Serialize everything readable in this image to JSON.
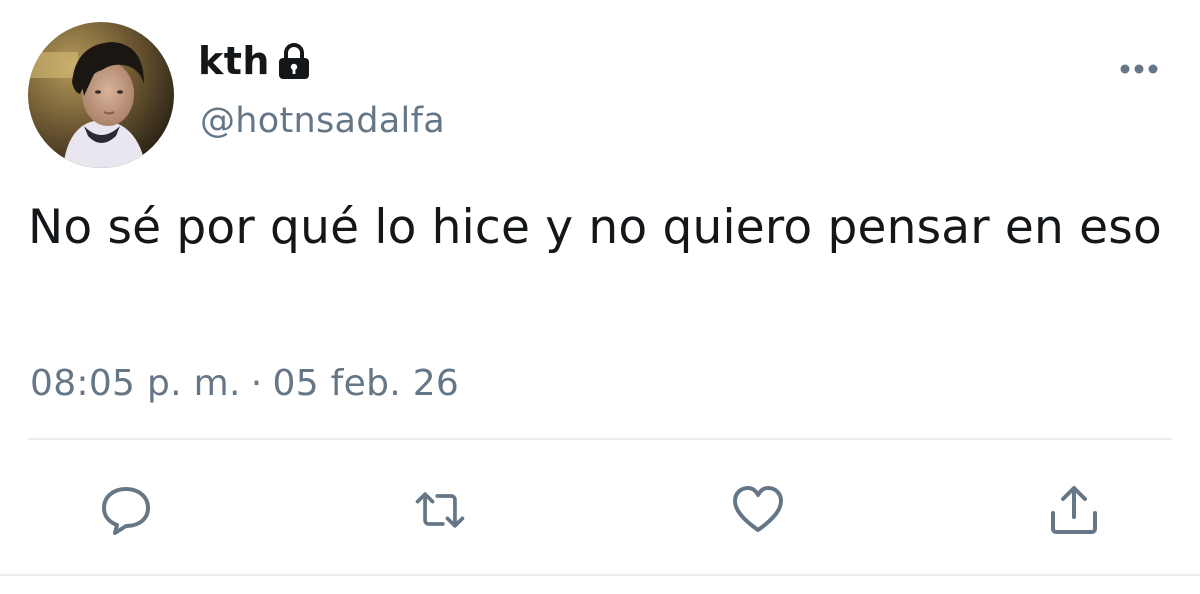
{
  "author": {
    "display_name": "kth",
    "handle": "@hotnsadalfa",
    "protected_icon": "lock-icon",
    "avatar": "avatar-photo"
  },
  "tweet": {
    "text": "No sé por qué lo hice y no quiero pensar en eso",
    "time": "08:05 p. m.",
    "separator": "·",
    "date": "05 feb. 26"
  },
  "header": {
    "menu_icon": "more-horizontal-icon"
  },
  "actions": [
    {
      "icon": "reply-icon"
    },
    {
      "icon": "retweet-icon"
    },
    {
      "icon": "like-icon"
    },
    {
      "icon": "share-icon"
    }
  ],
  "colors": {
    "primary_text": "#14171a",
    "secondary_text": "#657786",
    "divider": "#e6ecf0"
  }
}
